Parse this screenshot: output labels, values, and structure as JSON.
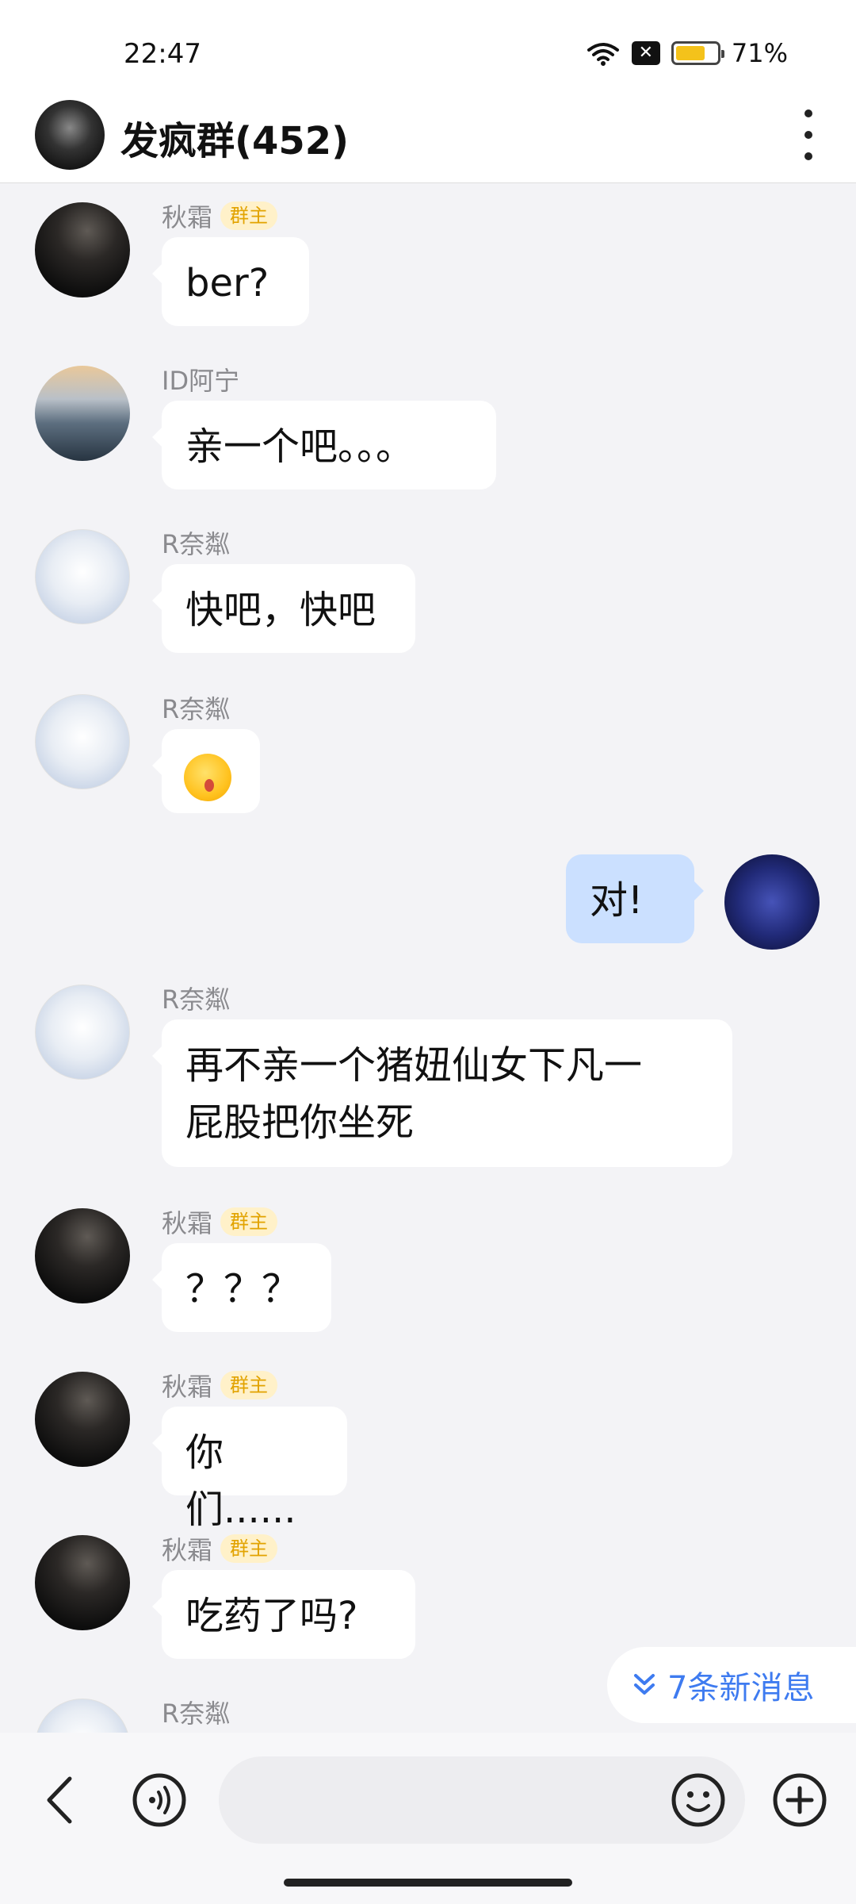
{
  "status_bar": {
    "time": "22:47",
    "battery": "71%"
  },
  "header": {
    "title": "发疯群(452)"
  },
  "messages": [
    {
      "sender": "秋霜",
      "badge": "群主",
      "text": "ber?"
    },
    {
      "sender": "ID阿宁",
      "badge": "",
      "text": "亲一个吧。。。"
    },
    {
      "sender": "R奈粼",
      "badge": "",
      "text": "快吧，快吧"
    },
    {
      "sender": "R奈粼",
      "badge": "",
      "text": ""
    },
    {
      "sender": "",
      "badge": "",
      "text": "对!"
    },
    {
      "sender": "R奈粼",
      "badge": "",
      "line1": "再不亲一个猪妞仙女下凡一",
      "line2": "屁股把你坐死"
    },
    {
      "sender": "秋霜",
      "badge": "群主",
      "text": "？？？"
    },
    {
      "sender": "秋霜",
      "badge": "群主",
      "text": "你们......"
    },
    {
      "sender": "秋霜",
      "badge": "群主",
      "text": "吃药了吗?"
    },
    {
      "sender": "R奈粼",
      "badge": "",
      "text": ""
    }
  ],
  "new_messages": {
    "label": "7条新消息"
  },
  "icons": {
    "wifi": "wifi-icon",
    "sim": "sim-off-icon",
    "battery": "battery-icon",
    "menu": "more-vertical-icon",
    "back": "back-icon",
    "voice": "voice-icon",
    "emoji": "smile-icon",
    "plus": "plus-icon",
    "new_message": "chevron-double-down-icon"
  },
  "colors": {
    "accent": "#3e7bf0",
    "my_bubble": "#cbe0ff",
    "badge_text": "#e2a300",
    "badge_bg": "#fff1c9"
  }
}
